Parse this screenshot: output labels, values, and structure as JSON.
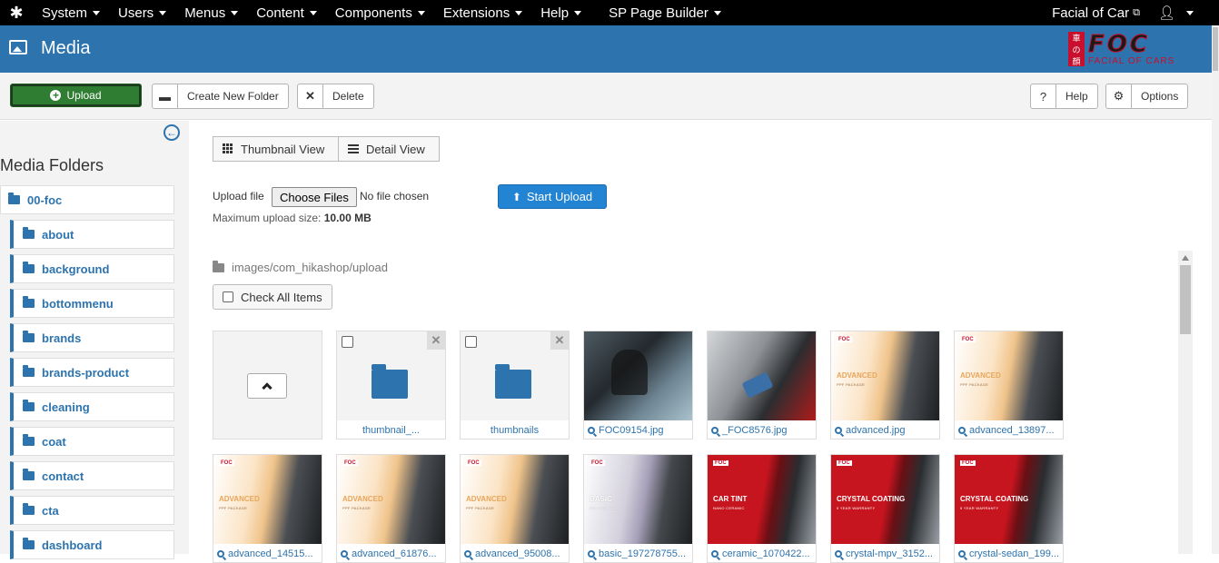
{
  "topnav": {
    "menus": [
      "System",
      "Users",
      "Menus",
      "Content",
      "Components",
      "Extensions",
      "Help",
      "SP Page Builder"
    ],
    "site_link": "Facial of Car"
  },
  "header": {
    "title": "Media",
    "logo_text": "FOC",
    "logo_tagline": "FACIAL OF CARS",
    "seal_chars": [
      "車",
      "の",
      "顔"
    ]
  },
  "toolbar": {
    "upload": "Upload",
    "create_folder": "Create New Folder",
    "delete": "Delete",
    "help": "Help",
    "options": "Options"
  },
  "sidebar": {
    "title": "Media Folders",
    "root": "00-foc",
    "folders": [
      "about",
      "background",
      "bottommenu",
      "brands",
      "brands-product",
      "cleaning",
      "coat",
      "contact",
      "cta",
      "dashboard"
    ]
  },
  "views": {
    "thumbnail": "Thumbnail View",
    "detail": "Detail View"
  },
  "upload_form": {
    "label": "Upload file",
    "choose": "Choose Files",
    "nofile": "No file chosen",
    "max_label": "Maximum upload size:",
    "max_value": "10.00 MB",
    "start": "Start Upload"
  },
  "path": "images/com_hikashop/upload",
  "check_all": "Check All Items",
  "tiles_row1": [
    {
      "kind": "up"
    },
    {
      "kind": "folder",
      "name": "thumbnail_..."
    },
    {
      "kind": "folder",
      "name": "thumbnails"
    },
    {
      "kind": "image",
      "name": "FOC09154.jpg",
      "art": "photo-dark"
    },
    {
      "kind": "image",
      "name": "_FOC8576.jpg",
      "art": "photo-red"
    },
    {
      "kind": "image",
      "name": "advanced.jpg",
      "art": "adv"
    },
    {
      "kind": "image",
      "name": "advanced_13897...",
      "art": "adv"
    }
  ],
  "tiles_row2": [
    {
      "kind": "image",
      "name": "advanced_14515...",
      "art": "adv"
    },
    {
      "kind": "image",
      "name": "advanced_61876...",
      "art": "adv"
    },
    {
      "kind": "image",
      "name": "advanced_95008...",
      "art": "adv"
    },
    {
      "kind": "image",
      "name": "basic_197278755...",
      "art": "basic"
    },
    {
      "kind": "image",
      "name": "ceramic_1070422...",
      "art": "red"
    },
    {
      "kind": "image",
      "name": "crystal-mpv_3152...",
      "art": "red"
    },
    {
      "kind": "image",
      "name": "crystal-sedan_199...",
      "art": "red"
    }
  ],
  "art_texts": {
    "adv": "ADVANCED",
    "adv_sub": "PPF PACKAGE",
    "basic": "BASIC",
    "basic_sub": "PPF PACKAGE",
    "ceramic": "CAR TINT",
    "ceramic_sub": "NANO CERAMIC",
    "crystal": "CRYSTAL COATING",
    "crystal_sub": "5 YEAR WARRANTY"
  },
  "colors": {
    "header_blue": "#2d73ad",
    "upload_green": "#2f7d32",
    "start_blue": "#2384d3",
    "brand_red": "#c8102e"
  }
}
